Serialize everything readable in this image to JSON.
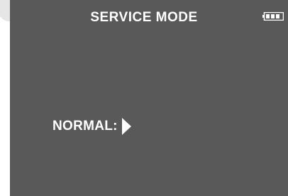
{
  "header": {
    "title": "SERVICE MODE",
    "battery_icon": "battery-icon"
  },
  "mode": {
    "label": "NORMAL:",
    "value": "",
    "arrow_icon": "play-arrow-icon"
  },
  "colors": {
    "screen_background": "#595959",
    "text": "#ffffff"
  }
}
